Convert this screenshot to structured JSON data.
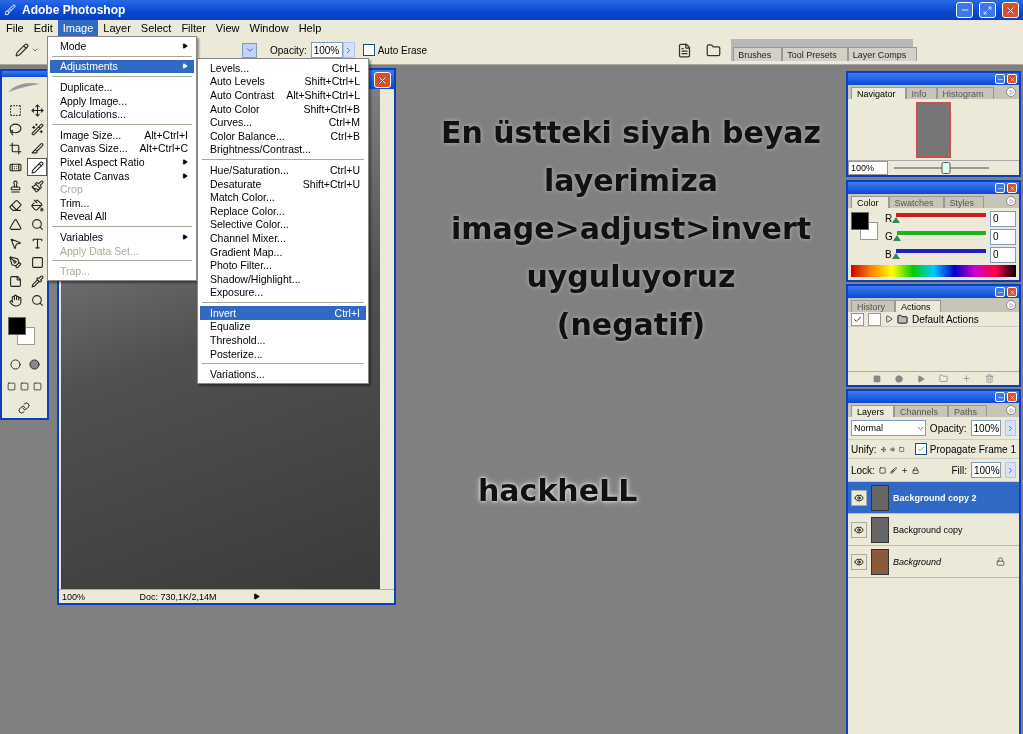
{
  "window": {
    "title": "Adobe Photoshop"
  },
  "menu_bar": [
    {
      "label": "File",
      "selected": false
    },
    {
      "label": "Edit",
      "selected": false
    },
    {
      "label": "Image",
      "selected": true
    },
    {
      "label": "Layer",
      "selected": false
    },
    {
      "label": "Select",
      "selected": false
    },
    {
      "label": "Filter",
      "selected": false
    },
    {
      "label": "View",
      "selected": false
    },
    {
      "label": "Window",
      "selected": false
    },
    {
      "label": "Help",
      "selected": false
    }
  ],
  "options_bar": {
    "opacity_label": "Opacity:",
    "opacity_value": "100%",
    "auto_erase": {
      "label": "Auto Erase",
      "checked": false
    },
    "palette_well_tabs": [
      "Brushes",
      "Tool Presets",
      "Layer Comps"
    ]
  },
  "image_menu": [
    {
      "kind": "item",
      "label": "Mode",
      "submenu": true,
      "disabled": false,
      "selected": false
    },
    {
      "kind": "separator"
    },
    {
      "kind": "item",
      "label": "Adjustments",
      "submenu": true,
      "disabled": false,
      "selected": true
    },
    {
      "kind": "separator"
    },
    {
      "kind": "item",
      "label": "Duplicate...",
      "submenu": false,
      "disabled": false,
      "selected": false
    },
    {
      "kind": "item",
      "label": "Apply Image...",
      "submenu": false,
      "disabled": false,
      "selected": false
    },
    {
      "kind": "item",
      "label": "Calculations...",
      "submenu": false,
      "disabled": false,
      "selected": false
    },
    {
      "kind": "separator"
    },
    {
      "kind": "item",
      "label": "Image Size...",
      "shortcut": "Alt+Ctrl+I",
      "submenu": false,
      "disabled": false,
      "selected": false
    },
    {
      "kind": "item",
      "label": "Canvas Size...",
      "shortcut": "Alt+Ctrl+C",
      "submenu": false,
      "disabled": false,
      "selected": false
    },
    {
      "kind": "item",
      "label": "Pixel Aspect Ratio",
      "submenu": true,
      "disabled": false,
      "selected": false
    },
    {
      "kind": "item",
      "label": "Rotate Canvas",
      "submenu": true,
      "disabled": false,
      "selected": false
    },
    {
      "kind": "item",
      "label": "Crop",
      "submenu": false,
      "disabled": true,
      "selected": false
    },
    {
      "kind": "item",
      "label": "Trim...",
      "submenu": false,
      "disabled": false,
      "selected": false
    },
    {
      "kind": "item",
      "label": "Reveal All",
      "submenu": false,
      "disabled": false,
      "selected": false
    },
    {
      "kind": "separator"
    },
    {
      "kind": "item",
      "label": "Variables",
      "submenu": true,
      "disabled": false,
      "selected": false
    },
    {
      "kind": "item",
      "label": "Apply Data Set...",
      "submenu": false,
      "disabled": true,
      "selected": false
    },
    {
      "kind": "separator"
    },
    {
      "kind": "item",
      "label": "Trap...",
      "submenu": false,
      "disabled": true,
      "selected": false
    }
  ],
  "adjustments_menu": [
    {
      "kind": "item",
      "label": "Levels...",
      "shortcut": "Ctrl+L",
      "selected": false
    },
    {
      "kind": "item",
      "label": "Auto Levels",
      "shortcut": "Shift+Ctrl+L",
      "selected": false
    },
    {
      "kind": "item",
      "label": "Auto Contrast",
      "shortcut": "Alt+Shift+Ctrl+L",
      "selected": false
    },
    {
      "kind": "item",
      "label": "Auto Color",
      "shortcut": "Shift+Ctrl+B",
      "selected": false
    },
    {
      "kind": "item",
      "label": "Curves...",
      "shortcut": "Ctrl+M",
      "selected": false
    },
    {
      "kind": "item",
      "label": "Color Balance...",
      "shortcut": "Ctrl+B",
      "selected": false
    },
    {
      "kind": "item",
      "label": "Brightness/Contrast...",
      "selected": false
    },
    {
      "kind": "separator"
    },
    {
      "kind": "item",
      "label": "Hue/Saturation...",
      "shortcut": "Ctrl+U",
      "selected": false
    },
    {
      "kind": "item",
      "label": "Desaturate",
      "shortcut": "Shift+Ctrl+U",
      "selected": false
    },
    {
      "kind": "item",
      "label": "Match Color...",
      "selected": false
    },
    {
      "kind": "item",
      "label": "Replace Color...",
      "selected": false
    },
    {
      "kind": "item",
      "label": "Selective Color...",
      "selected": false
    },
    {
      "kind": "item",
      "label": "Channel Mixer...",
      "selected": false
    },
    {
      "kind": "item",
      "label": "Gradient Map...",
      "selected": false
    },
    {
      "kind": "item",
      "label": "Photo Filter...",
      "selected": false
    },
    {
      "kind": "item",
      "label": "Shadow/Highlight...",
      "selected": false
    },
    {
      "kind": "item",
      "label": "Exposure...",
      "selected": false
    },
    {
      "kind": "separator"
    },
    {
      "kind": "item",
      "label": "Invert",
      "shortcut": "Ctrl+I",
      "selected": true
    },
    {
      "kind": "item",
      "label": "Equalize",
      "selected": false
    },
    {
      "kind": "item",
      "label": "Threshold...",
      "selected": false
    },
    {
      "kind": "item",
      "label": "Posterize...",
      "selected": false
    },
    {
      "kind": "separator"
    },
    {
      "kind": "item",
      "label": "Variations...",
      "selected": false
    }
  ],
  "tools": [
    {
      "kind": "marquee",
      "selected": false
    },
    {
      "kind": "move",
      "selected": false
    },
    {
      "kind": "lasso",
      "selected": false
    },
    {
      "kind": "wand",
      "selected": false
    },
    {
      "kind": "crop",
      "selected": false
    },
    {
      "kind": "slice",
      "selected": false
    },
    {
      "kind": "heal",
      "selected": false
    },
    {
      "kind": "pencil",
      "selected": true
    },
    {
      "kind": "stamp",
      "selected": false
    },
    {
      "kind": "history",
      "selected": false
    },
    {
      "kind": "eraser",
      "selected": false
    },
    {
      "kind": "bucket",
      "selected": false
    },
    {
      "kind": "blur",
      "selected": false
    },
    {
      "kind": "dodge",
      "selected": false
    },
    {
      "kind": "pointer",
      "selected": false
    },
    {
      "kind": "type",
      "selected": false
    },
    {
      "kind": "pen",
      "selected": false
    },
    {
      "kind": "shape",
      "selected": false
    },
    {
      "kind": "notes",
      "selected": false
    },
    {
      "kind": "eyedropper",
      "selected": false
    },
    {
      "kind": "hand",
      "selected": false
    },
    {
      "kind": "zoom",
      "selected": false
    }
  ],
  "document": {
    "zoom": "100%",
    "doc_info": "Doc: 730,1K/2,14M"
  },
  "annotation": {
    "lines": [
      "En üstteki siyah beyaz",
      "layerimiza",
      "image>adjust>invert",
      "uyguluyoruz",
      "(negatif)"
    ],
    "signature": "hackheLL"
  },
  "navigator": {
    "tabs": [
      {
        "label": "Navigator",
        "selected": true
      },
      {
        "label": "Info",
        "selected": false
      },
      {
        "label": "Histogram",
        "selected": false
      }
    ],
    "zoom": "100%",
    "level": 0.55
  },
  "color_palette": {
    "tabs": [
      {
        "label": "Color",
        "selected": true
      },
      {
        "label": "Swatches",
        "selected": false
      },
      {
        "label": "Styles",
        "selected": false
      }
    ],
    "channels": [
      {
        "label": "R",
        "value": "0",
        "color": "#cc2020",
        "level": 0
      },
      {
        "label": "G",
        "value": "0",
        "color": "#20b020",
        "level": 0
      },
      {
        "label": "B",
        "value": "0",
        "color": "#2020c0",
        "level": 0
      }
    ]
  },
  "actions_palette": {
    "tabs": [
      {
        "label": "History",
        "selected": false
      },
      {
        "label": "Actions",
        "selected": true
      }
    ],
    "items": [
      {
        "label": "Default Actions",
        "checked": true,
        "expanded": false
      }
    ]
  },
  "layers_palette": {
    "tabs": [
      {
        "label": "Layers",
        "selected": true
      },
      {
        "label": "Channels",
        "selected": false
      },
      {
        "label": "Paths",
        "selected": false
      }
    ],
    "blend_mode": "Normal",
    "opacity_label": "Opacity:",
    "opacity": "100%",
    "unify_label": "Unify:",
    "propagate": {
      "label": "Propagate Frame 1",
      "checked": true
    },
    "lock_label": "Lock:",
    "fill_label": "Fill:",
    "fill": "100%",
    "layers": [
      {
        "name": "Background copy 2",
        "kind": "layer",
        "selected": true,
        "visible": true,
        "locked": false
      },
      {
        "name": "Background copy",
        "kind": "layer",
        "selected": false,
        "visible": true,
        "locked": false
      },
      {
        "name": "Background",
        "kind": "background",
        "selected": false,
        "visible": true,
        "locked": true
      }
    ]
  }
}
